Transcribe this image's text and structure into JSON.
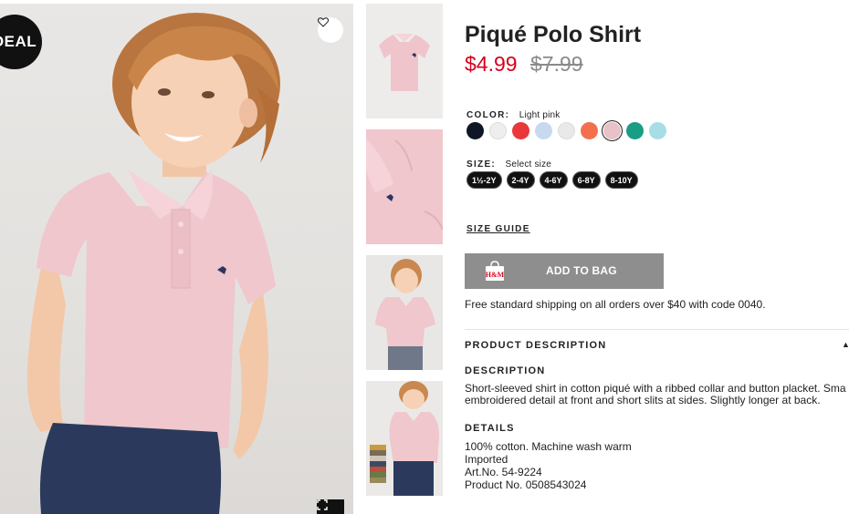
{
  "badge": {
    "deal_label": "DEAL"
  },
  "icons": {
    "favorite": "heart-icon",
    "zoom": "expand-icon",
    "bag": "shopping-bag-icon",
    "caret": "caret-up-icon"
  },
  "product": {
    "title": "Piqué Polo Shirt",
    "price_sale": "$4.99",
    "price_original": "$7.99",
    "color_label": "COLOR:",
    "color_value": "Light pink",
    "size_label": "SIZE:",
    "size_value": "Select size",
    "swatches": [
      "#0f1626",
      "#eeeeee",
      "#e8383b",
      "#c7d9ef",
      "#e9e9e9",
      "#f2704d",
      "#e7c2c6",
      "#1a9c85",
      "#a9dde6"
    ],
    "selected_swatch": "#e7c2c6",
    "sizes": [
      "1½-2Y",
      "2-4Y",
      "4-6Y",
      "6-8Y",
      "8-10Y"
    ],
    "size_guide": "SIZE GUIDE",
    "add_to_bag": "ADD TO BAG",
    "brand_mark": "H&M",
    "shipping_note": "Free standard shipping on all orders over $40 with code 0040."
  },
  "description": {
    "section_title": "PRODUCT DESCRIPTION",
    "description_heading": "DESCRIPTION",
    "description_line1": "Short-sleeved shirt in cotton piqué with a ribbed collar and button placket. Sma",
    "description_line2": "embroidered detail at front and short slits at sides. Slightly longer at back.",
    "details_heading": "DETAILS",
    "details": [
      "100% cotton. Machine wash warm",
      "Imported",
      "Art.No. 54-9224",
      "Product No. 0508543024"
    ]
  },
  "colors": {
    "sale_red": "#d6001c",
    "button_gray": "#8e8e8e",
    "shirt_pink": "#efc7cd"
  }
}
